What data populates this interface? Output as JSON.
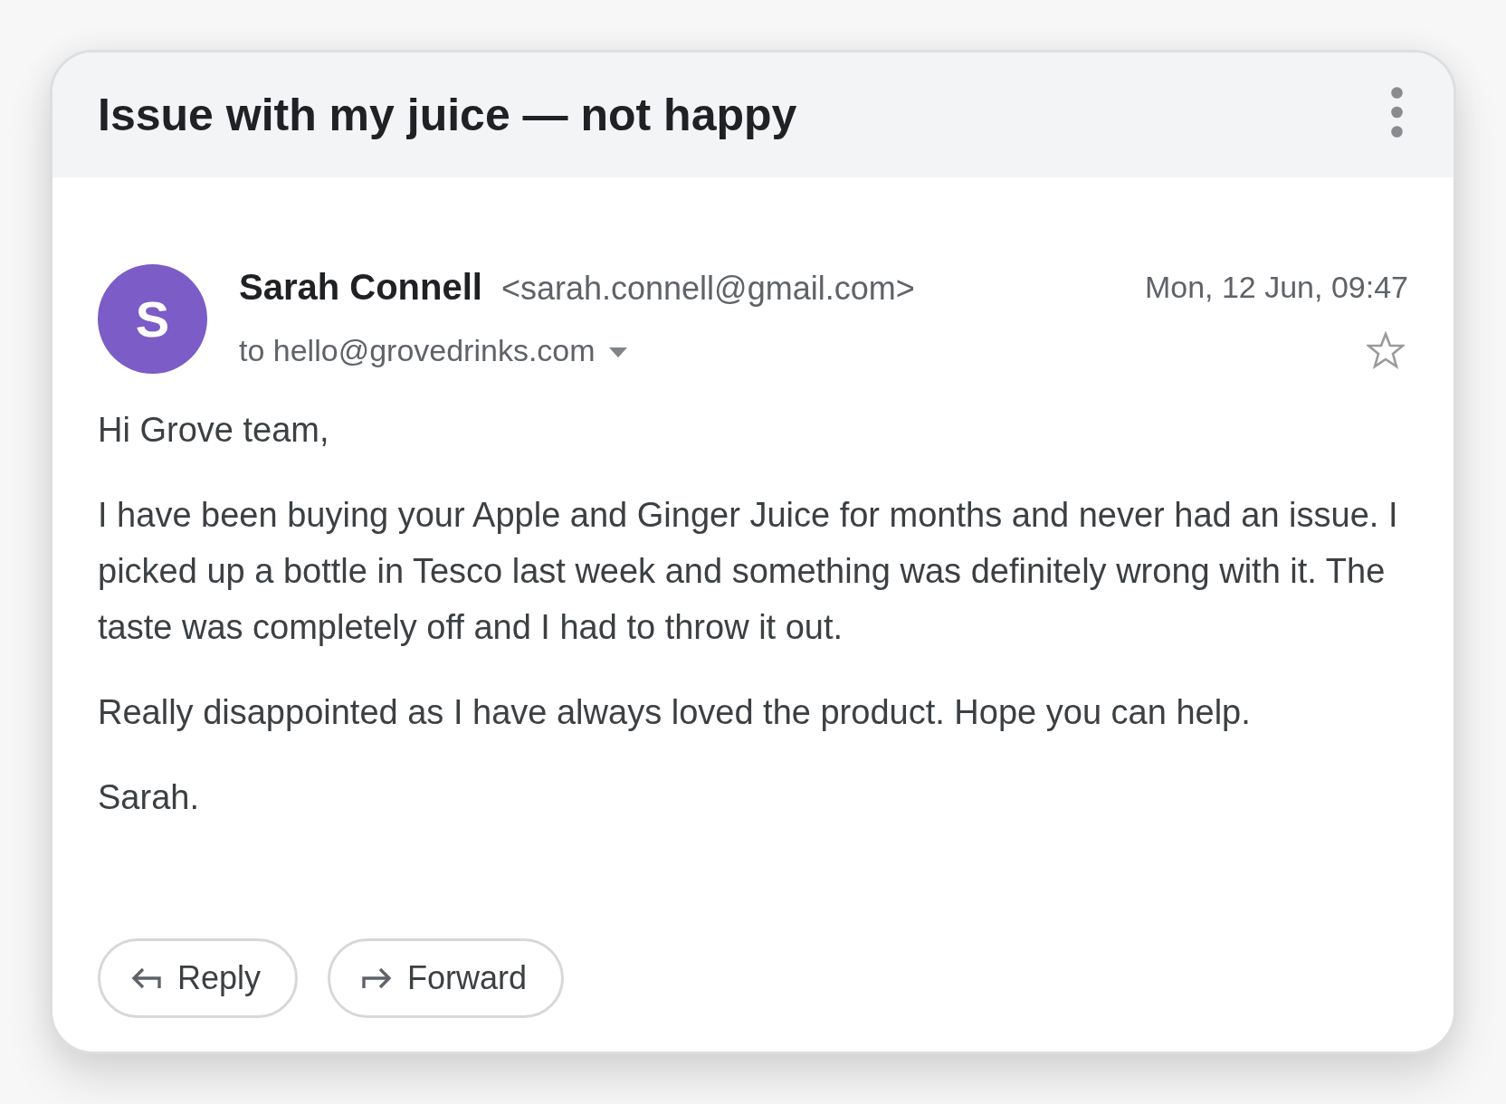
{
  "email": {
    "subject": "Issue with my juice — not happy",
    "sender": {
      "avatar_initial": "S",
      "name": "Sarah Connell",
      "address": "<sarah.connell@gmail.com>"
    },
    "recipient": "to hello@grovedrinks.com",
    "date": "Mon, 12 Jun, 09:47",
    "starred": false,
    "body": [
      "Hi Grove team,",
      "I have been buying your Apple and Ginger Juice for months and never had an issue. I picked up a bottle in Tesco last week and something was definitely wrong with it. The taste was completely off and I had to throw it out.",
      "Really disappointed as I have always loved the product. Hope you can help.",
      "Sarah."
    ],
    "actions": [
      {
        "label": "Reply",
        "kind": "reply"
      },
      {
        "label": "Forward",
        "kind": "forward"
      }
    ]
  }
}
